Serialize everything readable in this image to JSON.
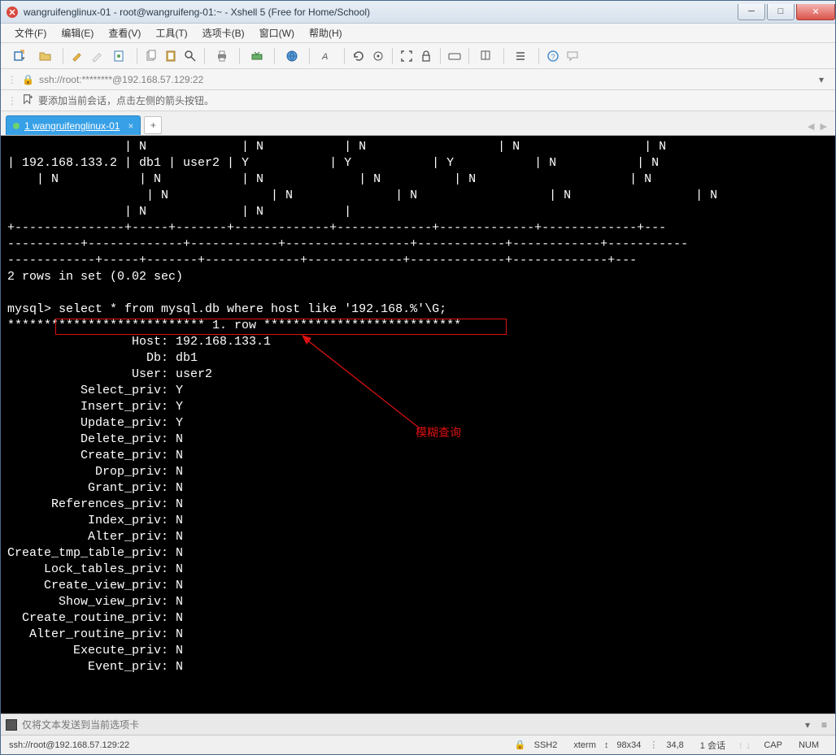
{
  "window": {
    "title": "wangruifenglinux-01 - root@wangruifeng-01:~ - Xshell 5 (Free for Home/School)"
  },
  "menu": {
    "file": "文件(F)",
    "edit": "编辑(E)",
    "view": "查看(V)",
    "tools": "工具(T)",
    "tabs": "选项卡(B)",
    "window": "窗口(W)",
    "help": "帮助(H)"
  },
  "address": {
    "text": "ssh://root:********@192.168.57.129:22"
  },
  "info": {
    "text": "要添加当前会话，点击左侧的箭头按钮。"
  },
  "tab": {
    "label": "1 wangruifenglinux-01"
  },
  "terminal": {
    "line01": "                | N             | N           | N                  | N                 | N",
    "line02": "| 192.168.133.2 | db1 | user2 | Y           | Y           | Y           | N           | N",
    "line03": "    | N           | N           | N             | N          | N                     | N",
    "line04": "                   | N              | N              | N                  | N                 | N",
    "line05": "                | N             | N           |",
    "line06": "+---------------+-----+-------+-------------+-------------+-------------+-------------+---",
    "line07": "----------+-------------+------------+-----------------+------------+------------+-----------",
    "line08": "------------+-----+-------+-------------+-------------+-------------+-------------+---",
    "line09": "2 rows in set (0.02 sec)",
    "line10": "",
    "prompt": "mysql>",
    "query": " select * from mysql.db where host like '192.168.%'\\G;",
    "row_header": "*************************** 1. row ***************************",
    "fields": [
      {
        "k": "                 Host:",
        "v": " 192.168.133.1"
      },
      {
        "k": "                   Db:",
        "v": " db1"
      },
      {
        "k": "                 User:",
        "v": " user2"
      },
      {
        "k": "          Select_priv:",
        "v": " Y"
      },
      {
        "k": "          Insert_priv:",
        "v": " Y"
      },
      {
        "k": "          Update_priv:",
        "v": " Y"
      },
      {
        "k": "          Delete_priv:",
        "v": " N"
      },
      {
        "k": "          Create_priv:",
        "v": " N"
      },
      {
        "k": "            Drop_priv:",
        "v": " N"
      },
      {
        "k": "           Grant_priv:",
        "v": " N"
      },
      {
        "k": "      References_priv:",
        "v": " N"
      },
      {
        "k": "           Index_priv:",
        "v": " N"
      },
      {
        "k": "           Alter_priv:",
        "v": " N"
      },
      {
        "k": "Create_tmp_table_priv:",
        "v": " N"
      },
      {
        "k": "     Lock_tables_priv:",
        "v": " N"
      },
      {
        "k": "     Create_view_priv:",
        "v": " N"
      },
      {
        "k": "       Show_view_priv:",
        "v": " N"
      },
      {
        "k": "  Create_routine_priv:",
        "v": " N"
      },
      {
        "k": "   Alter_routine_priv:",
        "v": " N"
      },
      {
        "k": "         Execute_priv:",
        "v": " N"
      },
      {
        "k": "           Event_priv:",
        "v": " N"
      }
    ]
  },
  "annotation": {
    "label": "模糊查询"
  },
  "sendbar": {
    "placeholder": "仅将文本发送到当前选项卡"
  },
  "status": {
    "conn": "ssh://root@192.168.57.129:22",
    "proto": "SSH2",
    "term": "xterm",
    "size": "98x34",
    "pos": "34,8",
    "sessions": "1 会话",
    "caps": "CAP",
    "num": "NUM"
  }
}
